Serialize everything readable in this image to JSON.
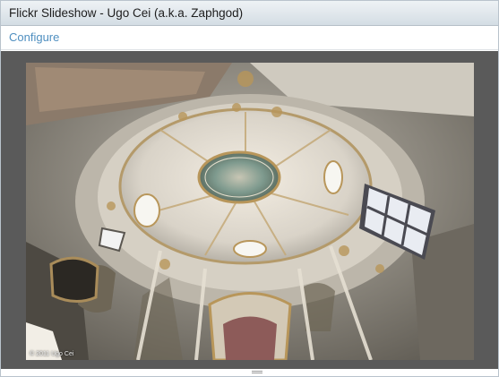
{
  "window": {
    "title": "Flickr Slideshow - Ugo Cei (a.k.a. Zaphgod)"
  },
  "menu": {
    "configure_label": "Configure"
  },
  "slideshow": {
    "photo_alt": "Baroque church dome interior viewed from below",
    "credit": "© 2011 Ugo Cei"
  },
  "colors": {
    "accent_link": "#4f8fc0",
    "stage_background": "#5a5a5a"
  },
  "icons": {
    "resize_grip": "resize-grip-icon"
  }
}
